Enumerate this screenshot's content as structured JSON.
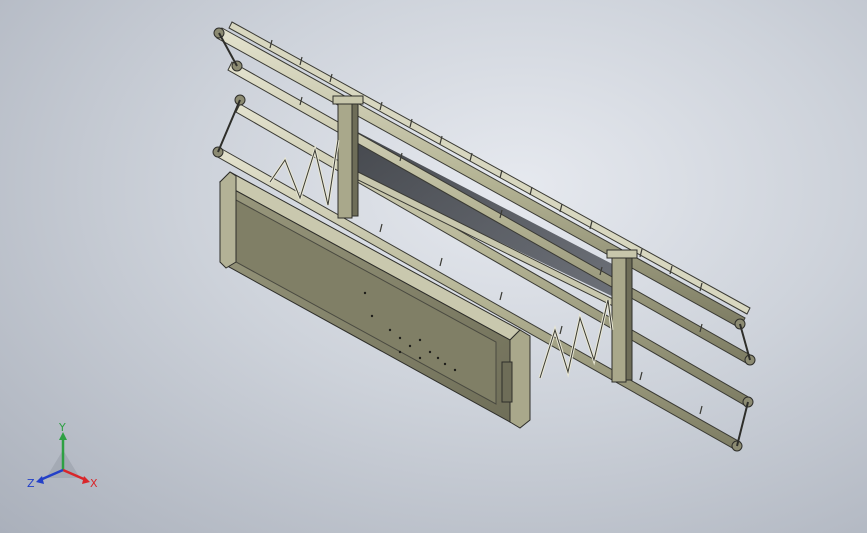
{
  "viewport": {
    "background": "#c4c9d1",
    "part_color": "#b9b89a",
    "panel_color": "#8e8d73",
    "edge_color": "#3a3a34"
  },
  "triad": {
    "x_label": "X",
    "y_label": "Y",
    "z_label": "Z",
    "x_color": "#d9262a",
    "y_color": "#2ea043",
    "z_color": "#2340c8"
  }
}
